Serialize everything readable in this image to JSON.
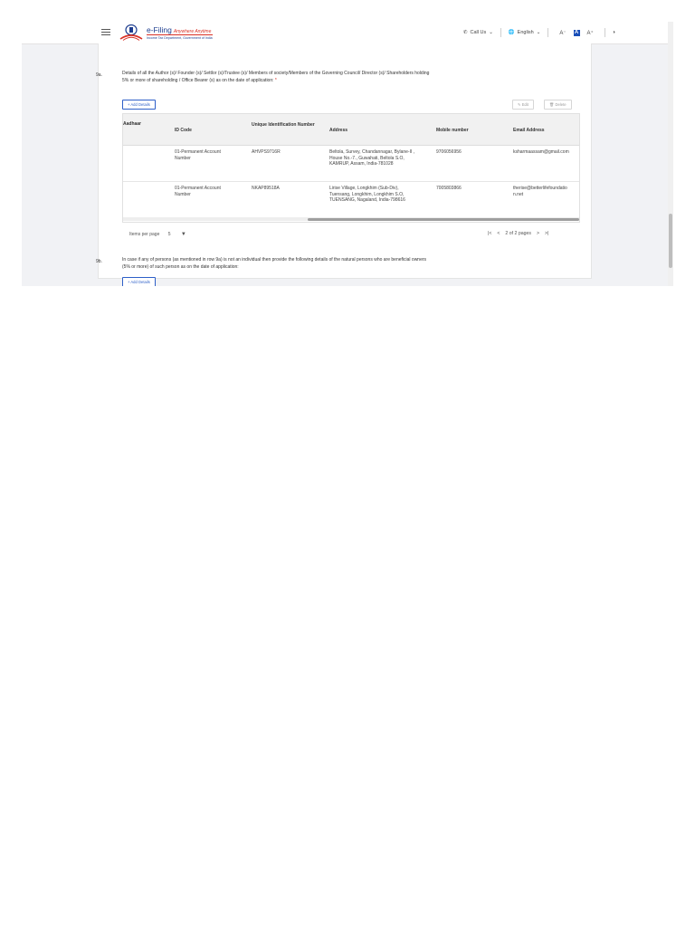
{
  "header": {
    "logo_title": "e-Filing",
    "logo_tagline": "Anywhere Anytime",
    "logo_subtitle": "Income Tax Department, Government of India",
    "call_us": "Call Us",
    "language": "English",
    "font_decrease": "A⁻",
    "font_normal": "A",
    "font_increase": "A⁺"
  },
  "section_9a": {
    "number": "9a.",
    "text": "Details of all the Author (s)/ Founder (s)/ Settlor (s)/Trustee (s)/ Members of society/Members of the Governing Council/ Director (s)/ Shareholders holding 5% or more of shareholding / Office Bearer (s) as on the date of application:",
    "required_mark": "*",
    "add_button": "+ Add Details",
    "edit_button": "Edit",
    "delete_button": "Delete"
  },
  "table": {
    "columns": [
      "Aadhaar",
      "ID Code",
      "Unique Identification Number",
      "Address",
      "Mobile number",
      "Email Address"
    ],
    "rows": [
      {
        "aadhaar": "",
        "id_code": "01-Permanent Account Number",
        "uin": "AHVPS9716R",
        "address": "Beltola, Survey, Chandannagar, Bylane-II , House No.-7., Guwahati, Beltola S.O, KAMRUP, Assam, India-781028",
        "mobile": "9706056956",
        "email": "ksharmaassam@gmail.com"
      },
      {
        "aadhaar": "",
        "id_code": "01-Permanent Account Number",
        "uin": "NKAP89518A",
        "address": "Lirise Village, Longkhim (Sub-Div), Tuensang, Longkhim, Longkhim S.O, TUENSANG, Nagaland, India-798616",
        "mobile": "7005803866",
        "email": "therise@betterlifefoundation.net"
      }
    ]
  },
  "pagination": {
    "items_per_page_label": "Items per page",
    "items_per_page_value": "5",
    "first": "|<",
    "prev": "<",
    "status": "2 of 2 pages",
    "next": ">",
    "last": ">|"
  },
  "section_9b": {
    "number": "9b.",
    "text": "In case if any of persons (as mentioned in row 9a) is not an individual then provide the following details of the natural persons who are beneficial owners (5% or more) of such person as on the date of application:",
    "add_button": "+ Add Details"
  }
}
